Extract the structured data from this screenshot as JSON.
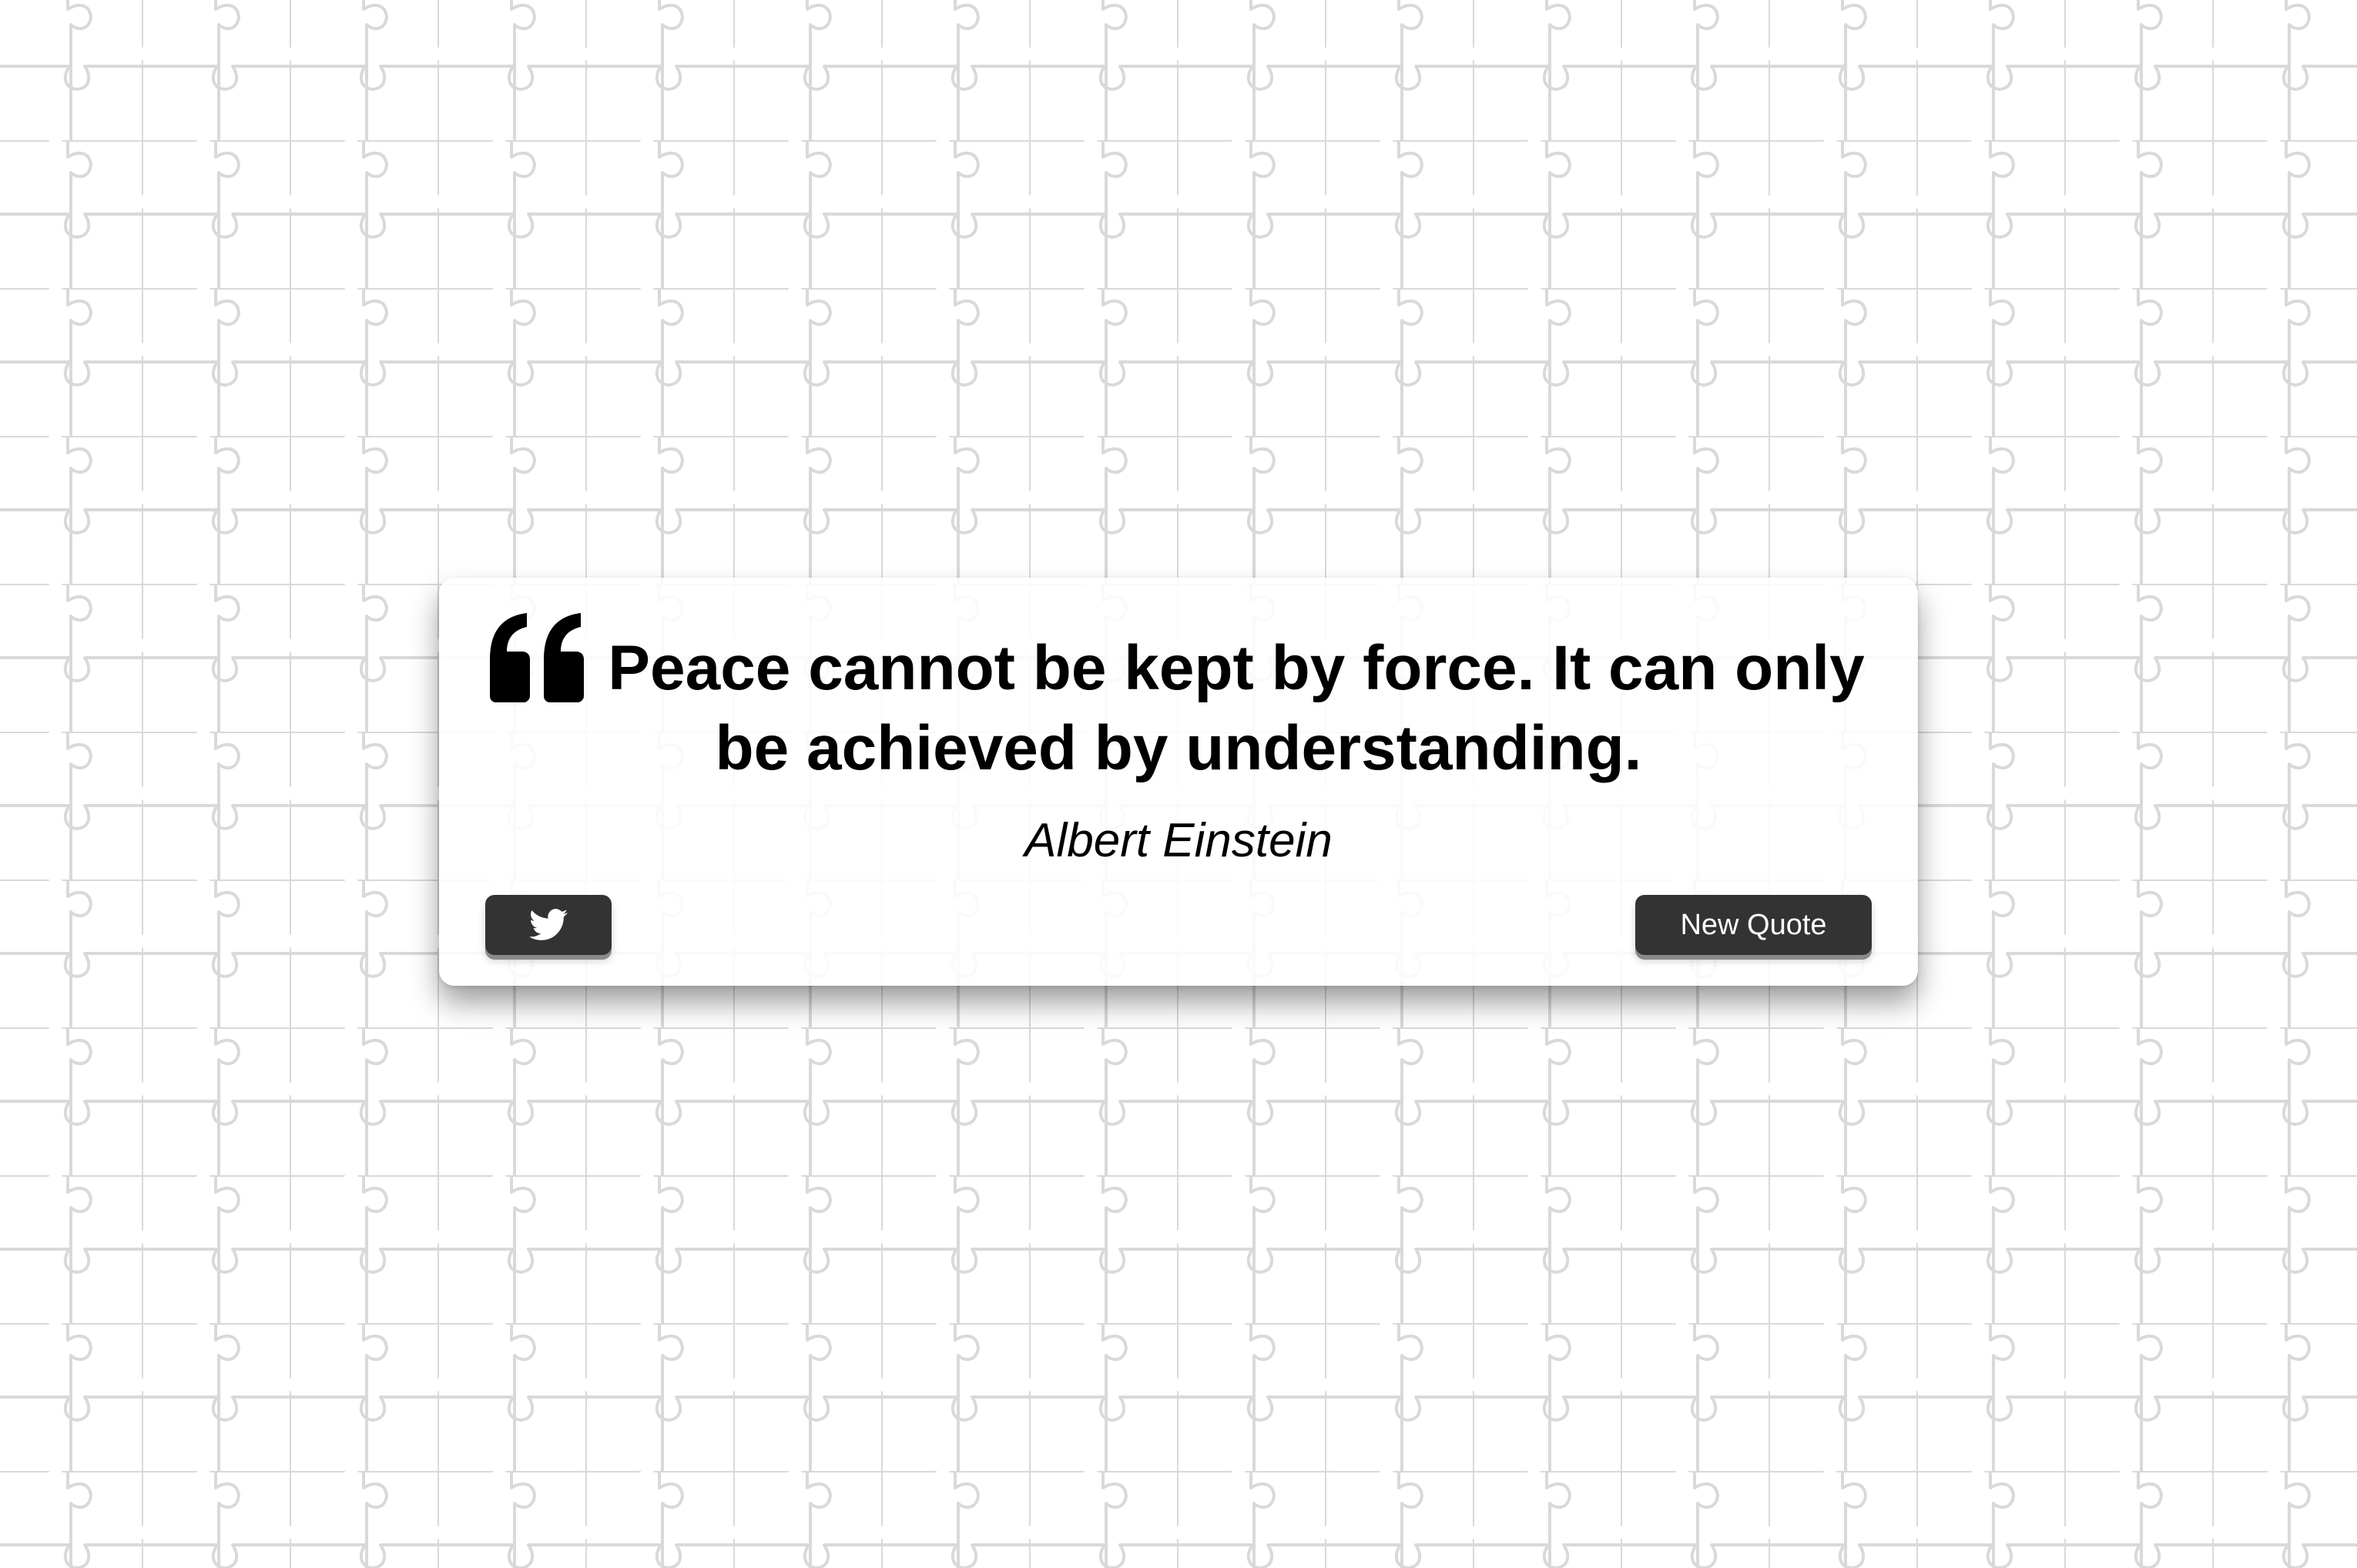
{
  "quote": {
    "text": "Peace cannot be kept by force. It can only be achieved by understanding.",
    "author": "Albert Einstein"
  },
  "buttons": {
    "tweet_icon": "twitter-bird-icon",
    "new_quote_label": "New Quote"
  },
  "icons": {
    "quote_mark": "quote-left-icon",
    "tweet": "twitter-icon"
  },
  "colors": {
    "page_background": "#ffffff",
    "puzzle_lines": "#d9d9d9",
    "card_background": "#ffffff",
    "button_background": "#333333",
    "button_text": "#ffffff",
    "text": "#000000"
  }
}
